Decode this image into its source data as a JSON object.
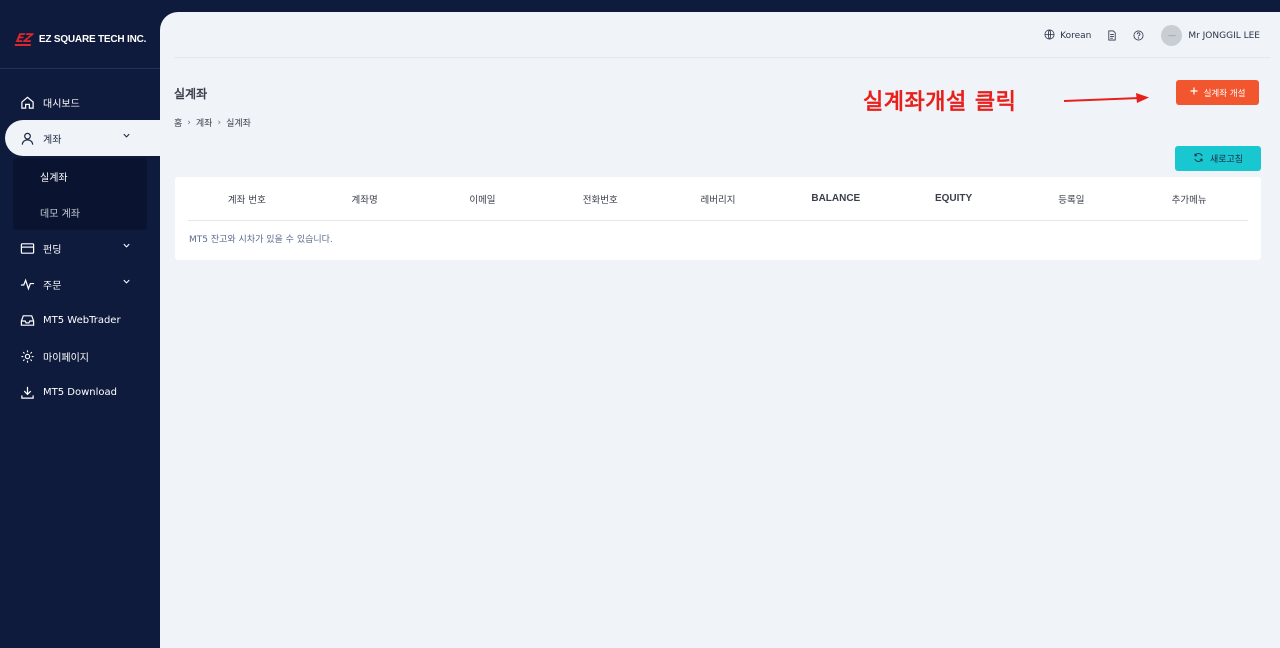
{
  "brand": {
    "mark": "EZ",
    "name": "EZ SQUARE TECH INC."
  },
  "sidebar": {
    "items": [
      {
        "label": "대시보드",
        "icon": "home-icon"
      },
      {
        "label": "계좌",
        "icon": "user-icon",
        "expanded": true
      },
      {
        "label": "펀딩",
        "icon": "card-icon"
      },
      {
        "label": "주문",
        "icon": "activity-icon"
      },
      {
        "label": "MT5 WebTrader",
        "icon": "inbox-icon"
      },
      {
        "label": "마이페이지",
        "icon": "gear-icon"
      },
      {
        "label": "MT5 Download",
        "icon": "download-icon"
      }
    ],
    "submenu": [
      {
        "label": "실계좌",
        "active": true
      },
      {
        "label": "데모 계좌",
        "active": false
      }
    ]
  },
  "topbar": {
    "language": "Korean",
    "user": "Mr JONGGIL LEE",
    "avatar_text": "—"
  },
  "page": {
    "title": "실계좌",
    "breadcrumb": [
      "홈",
      "계좌",
      "실계좌"
    ],
    "breadcrumb_sep": "›",
    "annotation": "실계좌개설 클릭",
    "open_button": "실계좌 개설",
    "refresh_button": "새로고침"
  },
  "table": {
    "columns": [
      "계좌 번호",
      "계좌명",
      "이메일",
      "전화번호",
      "레버리지",
      "BALANCE",
      "EQUITY",
      "등록일",
      "추가메뉴"
    ],
    "empty_message": "MT5 잔고와 시차가 있을 수 있습니다."
  },
  "colors": {
    "sidebar_bg": "#0f1b3d",
    "main_bg": "#f0f3f8",
    "accent_orange": "#f2562f",
    "accent_teal": "#18c7cf",
    "annotation_red": "#e8201c",
    "logo_red": "#e0262b"
  }
}
